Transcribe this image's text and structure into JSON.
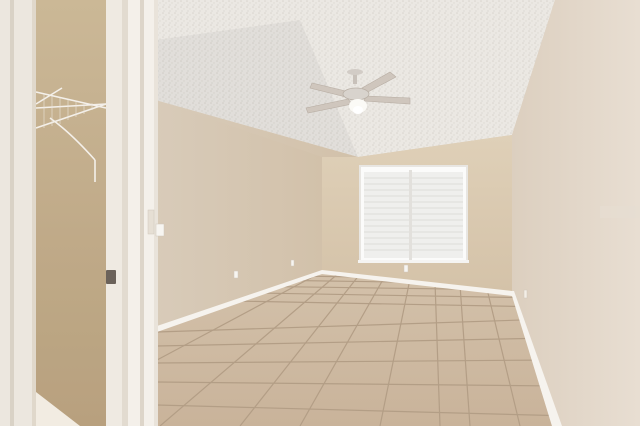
{
  "scene": {
    "description_free": true,
    "colors": {
      "ceiling": "#e9e6e0",
      "wall_back": "#dccbb1",
      "wall_left": "#d6c7b3",
      "wall_right": "#e2d6c8",
      "floor": "#cdb9a2",
      "grout": "#b5a08a",
      "baseboard": "#f6f3ee",
      "door_frame": "#efe9e0",
      "closet_interior": "#cdb795",
      "window_blind": "#f2f2f0",
      "fan": "#cfc9c3"
    },
    "icons": [
      "ceiling-fan-icon",
      "window-blinds-icon",
      "wire-shelf-icon",
      "door-latch-icon",
      "outlet-icon"
    ]
  }
}
